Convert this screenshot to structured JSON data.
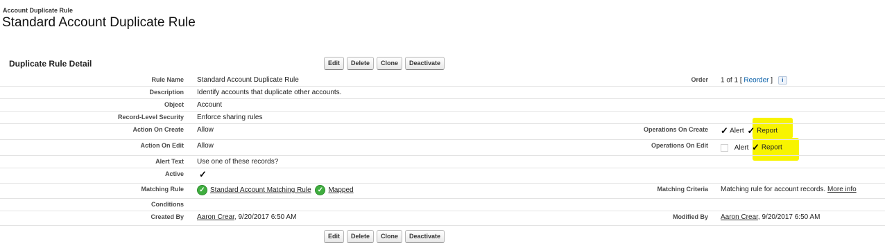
{
  "header": {
    "breadcrumb": "Account Duplicate Rule",
    "title": "Standard Account Duplicate Rule"
  },
  "section": {
    "title": "Duplicate Rule Detail"
  },
  "buttons": {
    "edit": "Edit",
    "delete": "Delete",
    "clone": "Clone",
    "deactivate": "Deactivate"
  },
  "fields": {
    "rule_name": {
      "label": "Rule Name",
      "value": "Standard Account Duplicate Rule"
    },
    "order": {
      "label": "Order",
      "value": "1 of 1",
      "bracket_open": "[",
      "reorder_link": "Reorder",
      "bracket_close": "]",
      "info_icon": "i"
    },
    "description": {
      "label": "Description",
      "value": "Identify accounts that duplicate other accounts."
    },
    "object": {
      "label": "Object",
      "value": "Account"
    },
    "record_level_security": {
      "label": "Record-Level Security",
      "value": "Enforce sharing rules"
    },
    "action_on_create": {
      "label": "Action On Create",
      "value": "Allow"
    },
    "operations_on_create": {
      "label": "Operations On Create",
      "alert_label": "Alert",
      "report_label": "Report",
      "alert_checked": true,
      "report_checked": true
    },
    "action_on_edit": {
      "label": "Action On Edit",
      "value": "Allow"
    },
    "operations_on_edit": {
      "label": "Operations On Edit",
      "alert_label": "Alert",
      "report_label": "Report",
      "alert_checked": false,
      "report_checked": true
    },
    "alert_text": {
      "label": "Alert Text",
      "value": "Use one of these records?"
    },
    "active": {
      "label": "Active",
      "checked": true
    },
    "matching_rule": {
      "label": "Matching Rule",
      "rule_link": "Standard Account Matching Rule",
      "status_link": "Mapped"
    },
    "matching_criteria": {
      "label": "Matching Criteria",
      "value": "Matching rule for account records.",
      "more_link": "More info"
    },
    "conditions": {
      "label": "Conditions",
      "value": ""
    },
    "created_by": {
      "label": "Created By",
      "user_link": "Aaron Crear",
      "date": ", 9/20/2017 6:50 AM"
    },
    "modified_by": {
      "label": "Modified By",
      "user_link": "Aaron Crear",
      "date": ", 9/20/2017 6:50 AM"
    }
  },
  "glyphs": {
    "check": "✓",
    "green_check": "✓"
  },
  "colors": {
    "highlight": "#f8f400",
    "link_blue": "#015ba7",
    "status_green": "#3fae3f"
  }
}
